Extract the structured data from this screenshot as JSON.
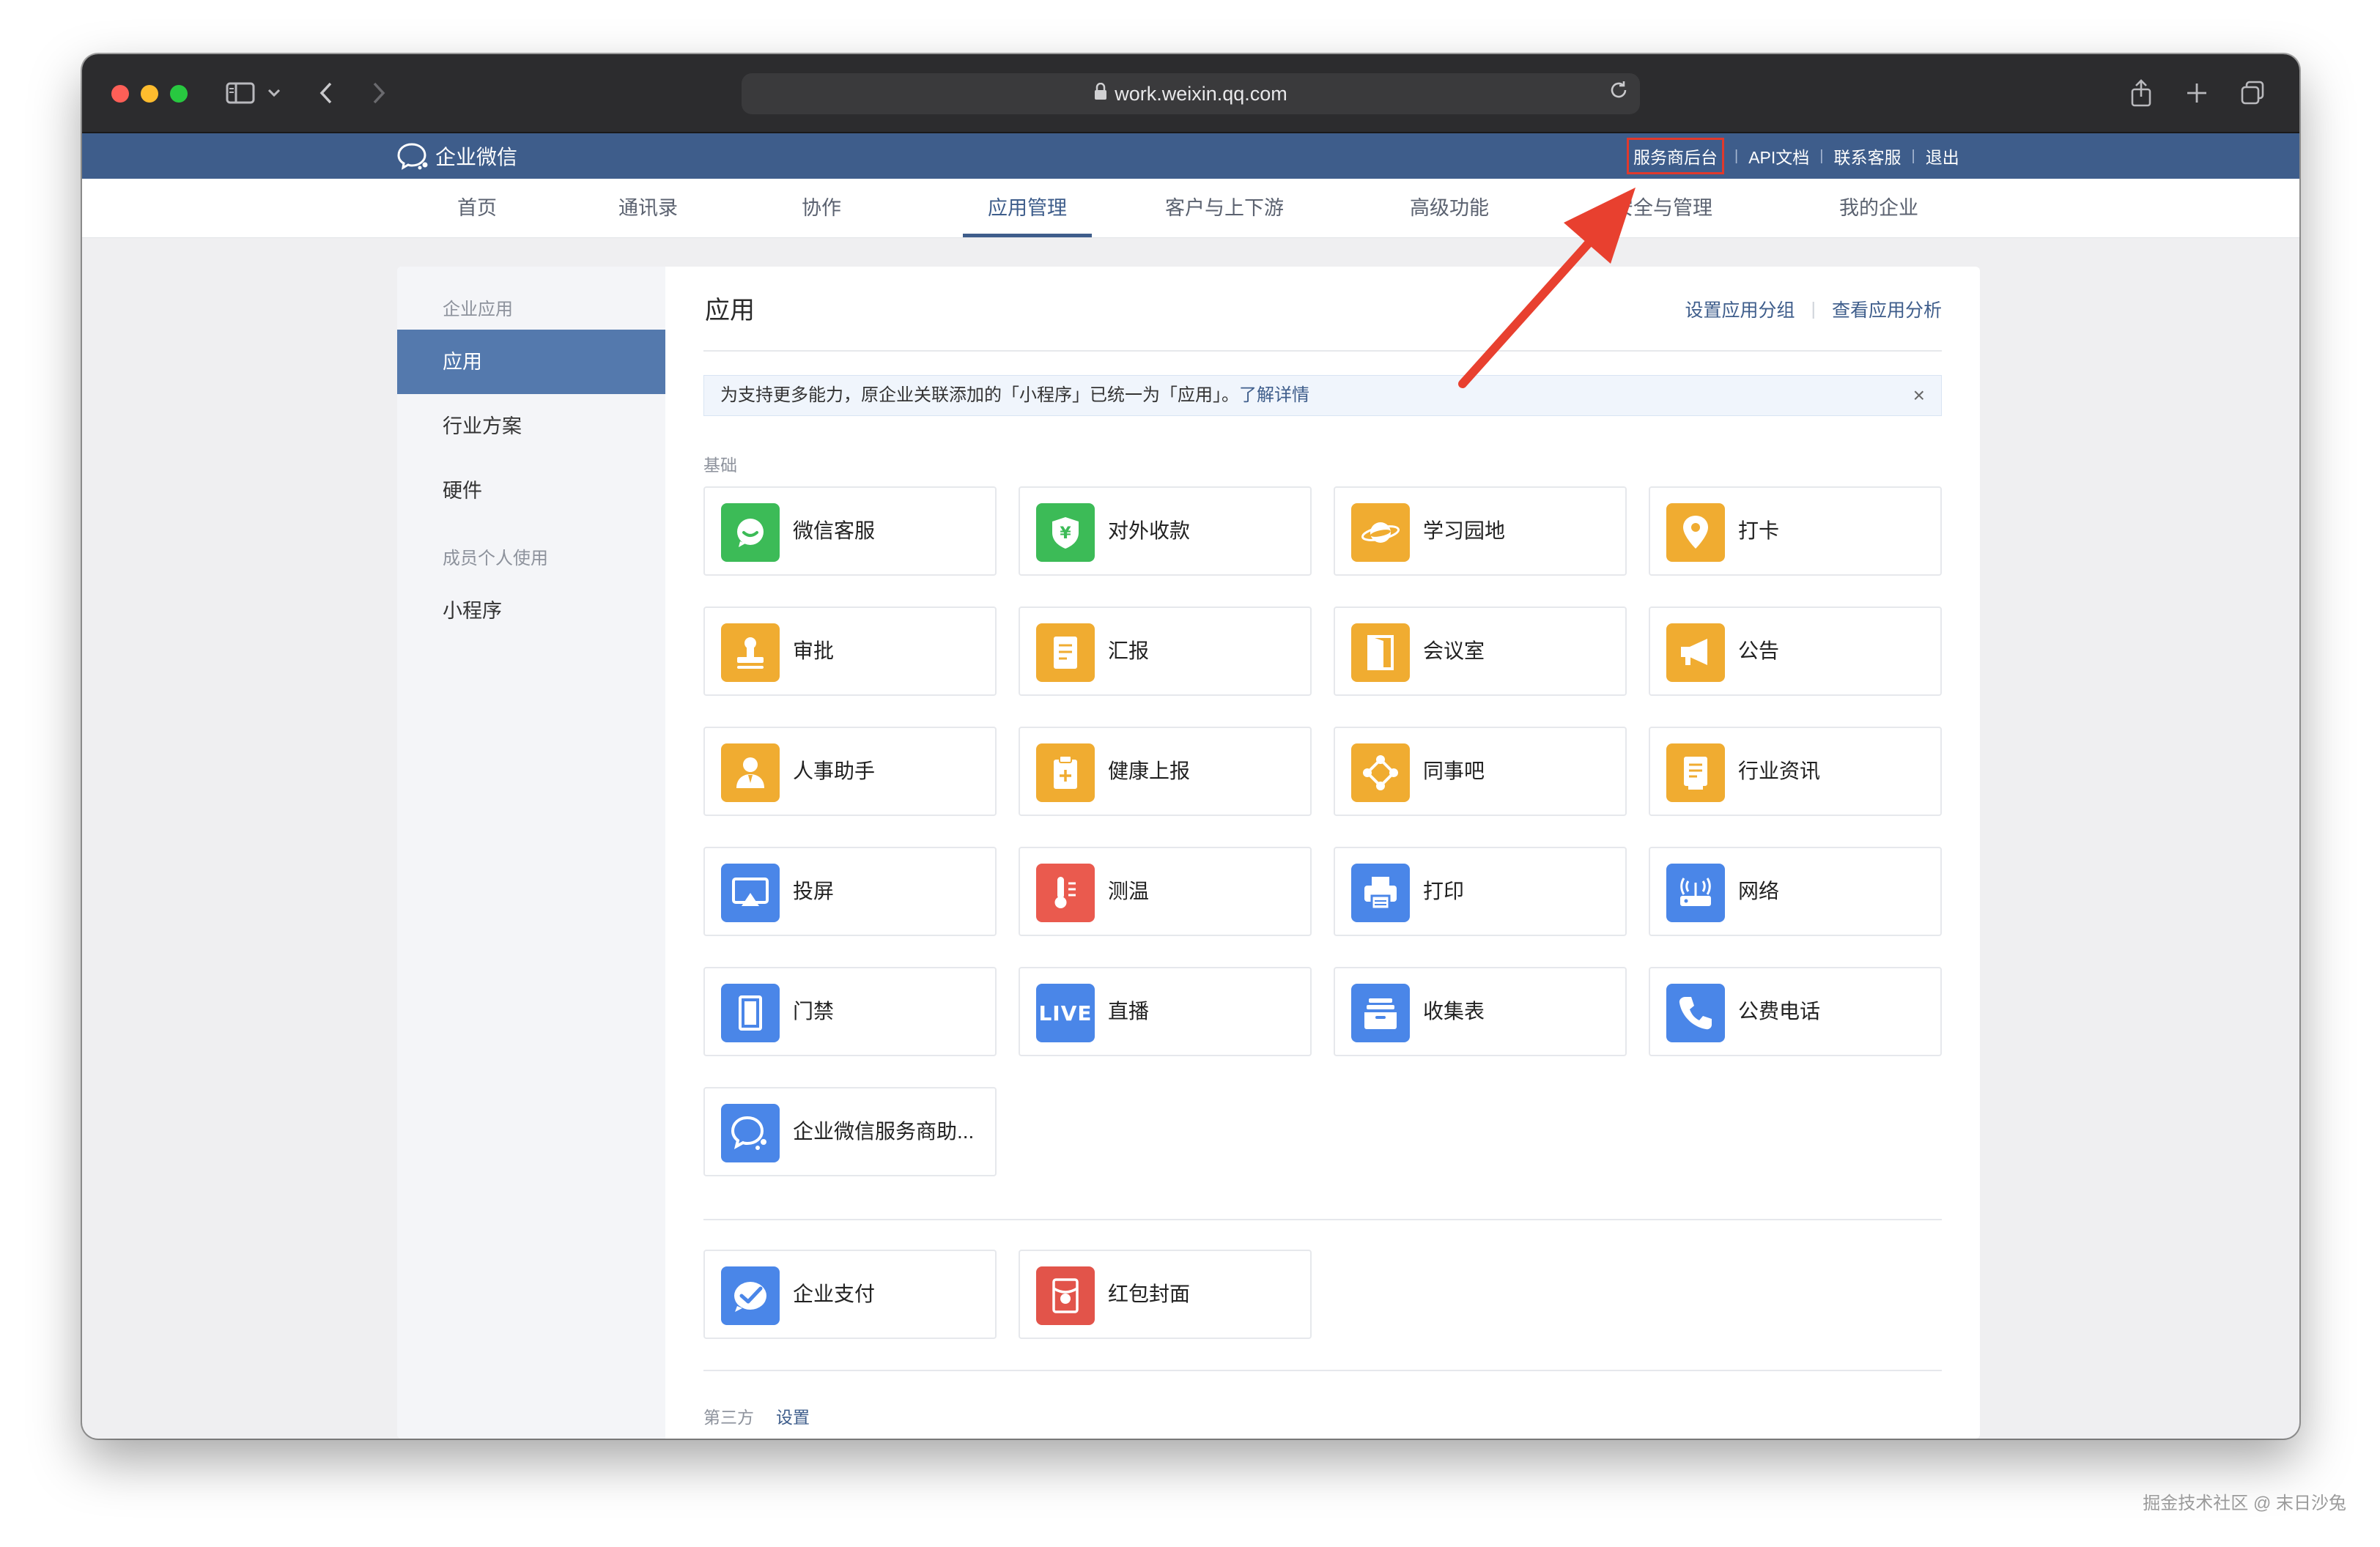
{
  "browser": {
    "url": "work.weixin.qq.com"
  },
  "app": {
    "logo_text": "企业微信",
    "top_links": [
      "服务商后台",
      "API文档",
      "联系客服",
      "退出"
    ]
  },
  "nav": {
    "items": [
      "首页",
      "通讯录",
      "协作",
      "应用管理",
      "客户与上下游",
      "高级功能",
      "安全与管理",
      "我的企业"
    ],
    "active": "应用管理"
  },
  "sidebar": {
    "group1": "企业应用",
    "items1": [
      "应用",
      "行业方案",
      "硬件"
    ],
    "group2": "成员个人使用",
    "items2": [
      "小程序"
    ],
    "active": "应用"
  },
  "main": {
    "title": "应用",
    "actions": [
      "设置应用分组",
      "查看应用分析"
    ],
    "notice": {
      "text": "为支持更多能力，原企业关联添加的「小程序」已统一为「应用」。",
      "link": "了解详情",
      "close": "×"
    },
    "section_basic": "基础",
    "apps_basic": [
      {
        "label": "微信客服",
        "icon": "wechat-service-icon",
        "color": "#3cbb57"
      },
      {
        "label": "对外收款",
        "icon": "yuan-shield-icon",
        "color": "#3cbb57"
      },
      {
        "label": "学习园地",
        "icon": "planet-icon",
        "color": "#f0ac31"
      },
      {
        "label": "打卡",
        "icon": "location-pin-icon",
        "color": "#f0ac31"
      },
      {
        "label": "审批",
        "icon": "stamp-icon",
        "color": "#f0ac31"
      },
      {
        "label": "汇报",
        "icon": "report-icon",
        "color": "#f0ac31"
      },
      {
        "label": "会议室",
        "icon": "door-icon",
        "color": "#f0ac31"
      },
      {
        "label": "公告",
        "icon": "megaphone-icon",
        "color": "#f0ac31"
      },
      {
        "label": "人事助手",
        "icon": "person-icon",
        "color": "#f0ac31"
      },
      {
        "label": "健康上报",
        "icon": "clipboard-plus-icon",
        "color": "#f0ac31"
      },
      {
        "label": "同事吧",
        "icon": "network-icon",
        "color": "#f0ac31"
      },
      {
        "label": "行业资讯",
        "icon": "news-icon",
        "color": "#f0ac31"
      },
      {
        "label": "投屏",
        "icon": "screen-cast-icon",
        "color": "#4a86e8"
      },
      {
        "label": "测温",
        "icon": "thermometer-icon",
        "color": "#ea5a4e"
      },
      {
        "label": "打印",
        "icon": "printer-icon",
        "color": "#4a86e8"
      },
      {
        "label": "网络",
        "icon": "wifi-router-icon",
        "color": "#4a86e8"
      },
      {
        "label": "门禁",
        "icon": "access-door-icon",
        "color": "#4a86e8"
      },
      {
        "label": "直播",
        "icon": "live-icon",
        "color": "#4a86e8",
        "badge": "LIVE"
      },
      {
        "label": "收集表",
        "icon": "tray-icon",
        "color": "#4a86e8"
      },
      {
        "label": "公费电话",
        "icon": "phone-icon",
        "color": "#4a86e8"
      },
      {
        "label": "企业微信服务商助...",
        "icon": "service-chat-icon",
        "color": "#4a86e8"
      }
    ],
    "apps_pay": [
      {
        "label": "企业支付",
        "icon": "pay-check-icon",
        "color": "#4a86e8"
      },
      {
        "label": "红包封面",
        "icon": "red-packet-icon",
        "color": "#e2544a"
      }
    ],
    "section_third": "第三方",
    "section_third_link": "设置"
  },
  "watermark": "掘金技术社区 @ 末日沙兔",
  "colors": {
    "brand": "#3e5d8b",
    "sidebar_active": "#5479ad",
    "highlight": "#e0392c"
  }
}
